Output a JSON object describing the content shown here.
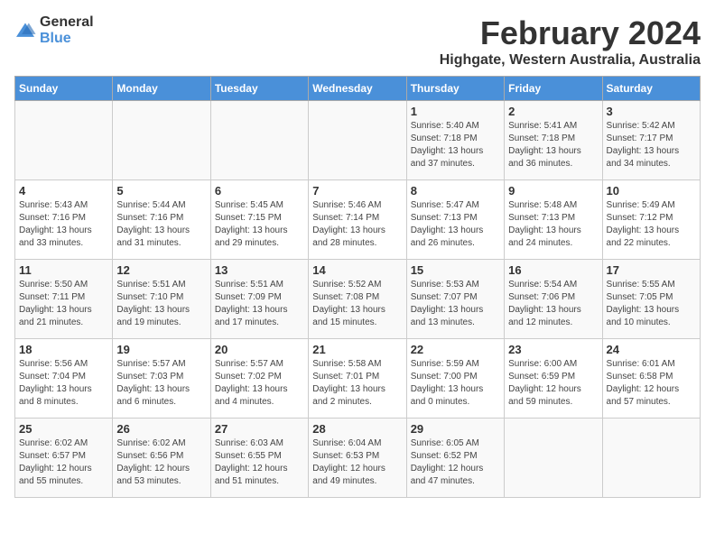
{
  "header": {
    "logo_general": "General",
    "logo_blue": "Blue",
    "month_title": "February 2024",
    "location": "Highgate, Western Australia, Australia"
  },
  "days_of_week": [
    "Sunday",
    "Monday",
    "Tuesday",
    "Wednesday",
    "Thursday",
    "Friday",
    "Saturday"
  ],
  "weeks": [
    [
      {
        "num": "",
        "info": ""
      },
      {
        "num": "",
        "info": ""
      },
      {
        "num": "",
        "info": ""
      },
      {
        "num": "",
        "info": ""
      },
      {
        "num": "1",
        "info": "Sunrise: 5:40 AM\nSunset: 7:18 PM\nDaylight: 13 hours and 37 minutes."
      },
      {
        "num": "2",
        "info": "Sunrise: 5:41 AM\nSunset: 7:18 PM\nDaylight: 13 hours and 36 minutes."
      },
      {
        "num": "3",
        "info": "Sunrise: 5:42 AM\nSunset: 7:17 PM\nDaylight: 13 hours and 34 minutes."
      }
    ],
    [
      {
        "num": "4",
        "info": "Sunrise: 5:43 AM\nSunset: 7:16 PM\nDaylight: 13 hours and 33 minutes."
      },
      {
        "num": "5",
        "info": "Sunrise: 5:44 AM\nSunset: 7:16 PM\nDaylight: 13 hours and 31 minutes."
      },
      {
        "num": "6",
        "info": "Sunrise: 5:45 AM\nSunset: 7:15 PM\nDaylight: 13 hours and 29 minutes."
      },
      {
        "num": "7",
        "info": "Sunrise: 5:46 AM\nSunset: 7:14 PM\nDaylight: 13 hours and 28 minutes."
      },
      {
        "num": "8",
        "info": "Sunrise: 5:47 AM\nSunset: 7:13 PM\nDaylight: 13 hours and 26 minutes."
      },
      {
        "num": "9",
        "info": "Sunrise: 5:48 AM\nSunset: 7:13 PM\nDaylight: 13 hours and 24 minutes."
      },
      {
        "num": "10",
        "info": "Sunrise: 5:49 AM\nSunset: 7:12 PM\nDaylight: 13 hours and 22 minutes."
      }
    ],
    [
      {
        "num": "11",
        "info": "Sunrise: 5:50 AM\nSunset: 7:11 PM\nDaylight: 13 hours and 21 minutes."
      },
      {
        "num": "12",
        "info": "Sunrise: 5:51 AM\nSunset: 7:10 PM\nDaylight: 13 hours and 19 minutes."
      },
      {
        "num": "13",
        "info": "Sunrise: 5:51 AM\nSunset: 7:09 PM\nDaylight: 13 hours and 17 minutes."
      },
      {
        "num": "14",
        "info": "Sunrise: 5:52 AM\nSunset: 7:08 PM\nDaylight: 13 hours and 15 minutes."
      },
      {
        "num": "15",
        "info": "Sunrise: 5:53 AM\nSunset: 7:07 PM\nDaylight: 13 hours and 13 minutes."
      },
      {
        "num": "16",
        "info": "Sunrise: 5:54 AM\nSunset: 7:06 PM\nDaylight: 13 hours and 12 minutes."
      },
      {
        "num": "17",
        "info": "Sunrise: 5:55 AM\nSunset: 7:05 PM\nDaylight: 13 hours and 10 minutes."
      }
    ],
    [
      {
        "num": "18",
        "info": "Sunrise: 5:56 AM\nSunset: 7:04 PM\nDaylight: 13 hours and 8 minutes."
      },
      {
        "num": "19",
        "info": "Sunrise: 5:57 AM\nSunset: 7:03 PM\nDaylight: 13 hours and 6 minutes."
      },
      {
        "num": "20",
        "info": "Sunrise: 5:57 AM\nSunset: 7:02 PM\nDaylight: 13 hours and 4 minutes."
      },
      {
        "num": "21",
        "info": "Sunrise: 5:58 AM\nSunset: 7:01 PM\nDaylight: 13 hours and 2 minutes."
      },
      {
        "num": "22",
        "info": "Sunrise: 5:59 AM\nSunset: 7:00 PM\nDaylight: 13 hours and 0 minutes."
      },
      {
        "num": "23",
        "info": "Sunrise: 6:00 AM\nSunset: 6:59 PM\nDaylight: 12 hours and 59 minutes."
      },
      {
        "num": "24",
        "info": "Sunrise: 6:01 AM\nSunset: 6:58 PM\nDaylight: 12 hours and 57 minutes."
      }
    ],
    [
      {
        "num": "25",
        "info": "Sunrise: 6:02 AM\nSunset: 6:57 PM\nDaylight: 12 hours and 55 minutes."
      },
      {
        "num": "26",
        "info": "Sunrise: 6:02 AM\nSunset: 6:56 PM\nDaylight: 12 hours and 53 minutes."
      },
      {
        "num": "27",
        "info": "Sunrise: 6:03 AM\nSunset: 6:55 PM\nDaylight: 12 hours and 51 minutes."
      },
      {
        "num": "28",
        "info": "Sunrise: 6:04 AM\nSunset: 6:53 PM\nDaylight: 12 hours and 49 minutes."
      },
      {
        "num": "29",
        "info": "Sunrise: 6:05 AM\nSunset: 6:52 PM\nDaylight: 12 hours and 47 minutes."
      },
      {
        "num": "",
        "info": ""
      },
      {
        "num": "",
        "info": ""
      }
    ]
  ]
}
